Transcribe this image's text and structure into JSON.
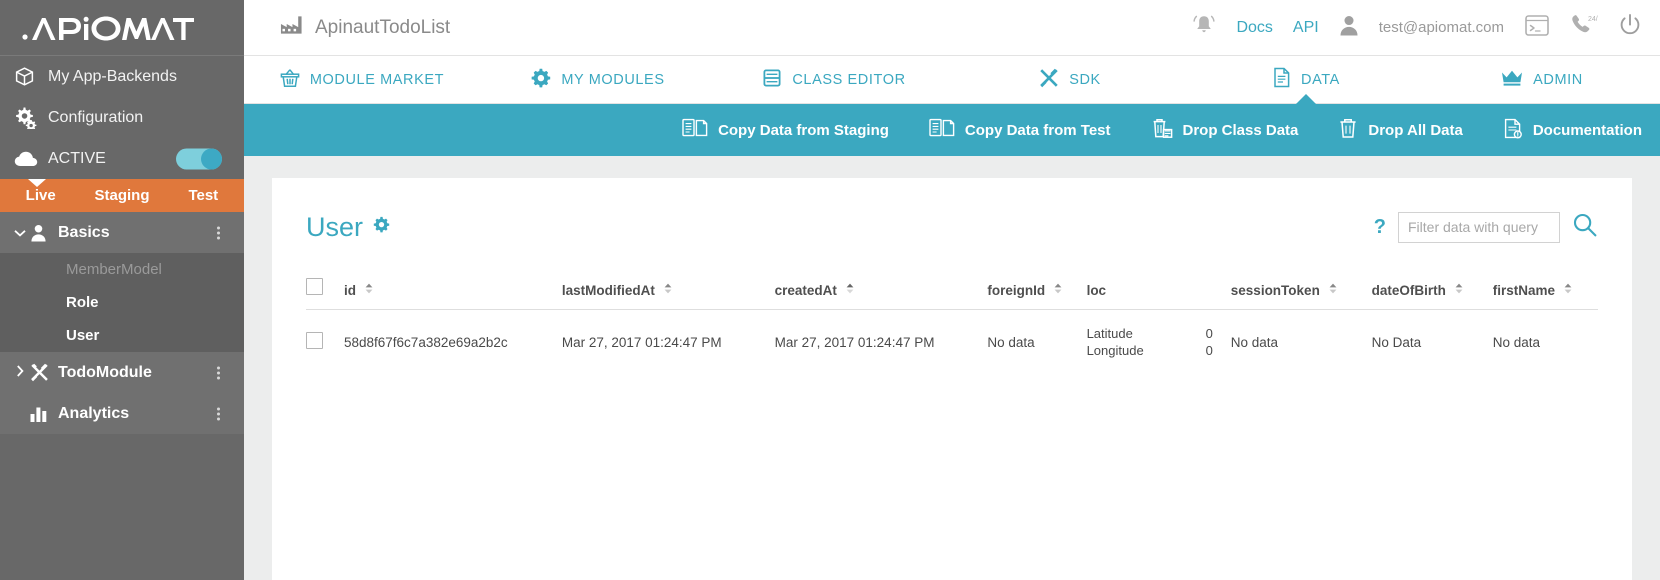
{
  "sidebar": {
    "logo": "APIOMAT",
    "items": [
      {
        "label": "My App-Backends",
        "icon": "cube-icon"
      },
      {
        "label": "Configuration",
        "icon": "gears-icon"
      },
      {
        "label": "ACTIVE",
        "icon": "cloud-icon",
        "toggle": true
      }
    ],
    "env_tabs": [
      {
        "label": "Live",
        "active": true
      },
      {
        "label": "Staging",
        "active": false
      },
      {
        "label": "Test",
        "active": false
      }
    ],
    "tree": [
      {
        "label": "Basics",
        "icon": "person-icon",
        "expanded": true,
        "chevron": "chevron-down-icon",
        "children": [
          {
            "label": "MemberModel",
            "dim": true
          },
          {
            "label": "Role",
            "dim": false
          },
          {
            "label": "User",
            "dim": false,
            "selected": true
          }
        ]
      },
      {
        "label": "TodoModule",
        "icon": "tools-icon",
        "expanded": false,
        "chevron": "chevron-right-icon",
        "children": []
      },
      {
        "label": "Analytics",
        "icon": "chart-icon",
        "expanded": false,
        "chevron": "",
        "children": []
      }
    ]
  },
  "topbar": {
    "backend_name": "ApinautTodoList",
    "backend_icon": "factory-icon",
    "bell_icon": "bell-icon",
    "docs_label": "Docs",
    "api_label": "API",
    "user_icon": "person-icon",
    "user_email": "test@apiomat.com",
    "console_icon": "terminal-icon",
    "support_icon": "phone-247-icon",
    "power_icon": "power-icon"
  },
  "nav": [
    {
      "label": "MODULE MARKET",
      "icon": "basket-icon",
      "active": false
    },
    {
      "label": "MY MODULES",
      "icon": "gear-icon",
      "active": false
    },
    {
      "label": "CLASS EDITOR",
      "icon": "class-editor-icon",
      "active": false
    },
    {
      "label": "SDK",
      "icon": "tools-icon",
      "active": false
    },
    {
      "label": "DATA",
      "icon": "document-icon",
      "active": true
    },
    {
      "label": "ADMIN",
      "icon": "crown-icon",
      "active": false
    }
  ],
  "toolbar": [
    {
      "label": "Copy Data from Staging",
      "icon": "copy-documents-icon"
    },
    {
      "label": "Copy Data from Test",
      "icon": "copy-documents-icon"
    },
    {
      "label": "Drop Class Data",
      "icon": "trash-class-icon"
    },
    {
      "label": "Drop All Data",
      "icon": "trash-icon"
    },
    {
      "label": "Documentation",
      "icon": "doc-info-icon"
    }
  ],
  "content": {
    "title": "User",
    "title_gear_icon": "gear-icon",
    "help_label": "?",
    "filter_placeholder": "Filter data with query",
    "filter_value": "",
    "search_icon": "search-icon",
    "table": {
      "columns": [
        {
          "key": "checkbox",
          "label": "",
          "sortable": false
        },
        {
          "key": "id",
          "label": "id",
          "sortable": true
        },
        {
          "key": "lastModifiedAt",
          "label": "lastModifiedAt",
          "sortable": true
        },
        {
          "key": "createdAt",
          "label": "createdAt",
          "sortable": true
        },
        {
          "key": "foreignId",
          "label": "foreignId",
          "sortable": true
        },
        {
          "key": "loc",
          "label": "loc",
          "sortable": false
        },
        {
          "key": "sessionToken",
          "label": "sessionToken",
          "sortable": true
        },
        {
          "key": "dateOfBirth",
          "label": "dateOfBirth",
          "sortable": true
        },
        {
          "key": "firstName",
          "label": "firstName",
          "sortable": true
        }
      ],
      "rows": [
        {
          "id": "58d8f67f6c7a382e69a2b2c",
          "lastModifiedAt": "Mar 27, 2017 01:24:47 PM",
          "createdAt": "Mar 27, 2017 01:24:47 PM",
          "foreignId": "No data",
          "loc": {
            "lat_label": "Latitude",
            "lat_value": "0",
            "lon_label": "Longitude",
            "lon_value": "0"
          },
          "sessionToken": "No data",
          "dateOfBirth": "No Data",
          "firstName": "No data"
        }
      ]
    }
  },
  "colors": {
    "teal": "#3ba8c0",
    "orange": "#e0783c",
    "sidebar": "#686868",
    "sidebar_group": "#707070",
    "sidebar_child": "#5f5f5f"
  }
}
